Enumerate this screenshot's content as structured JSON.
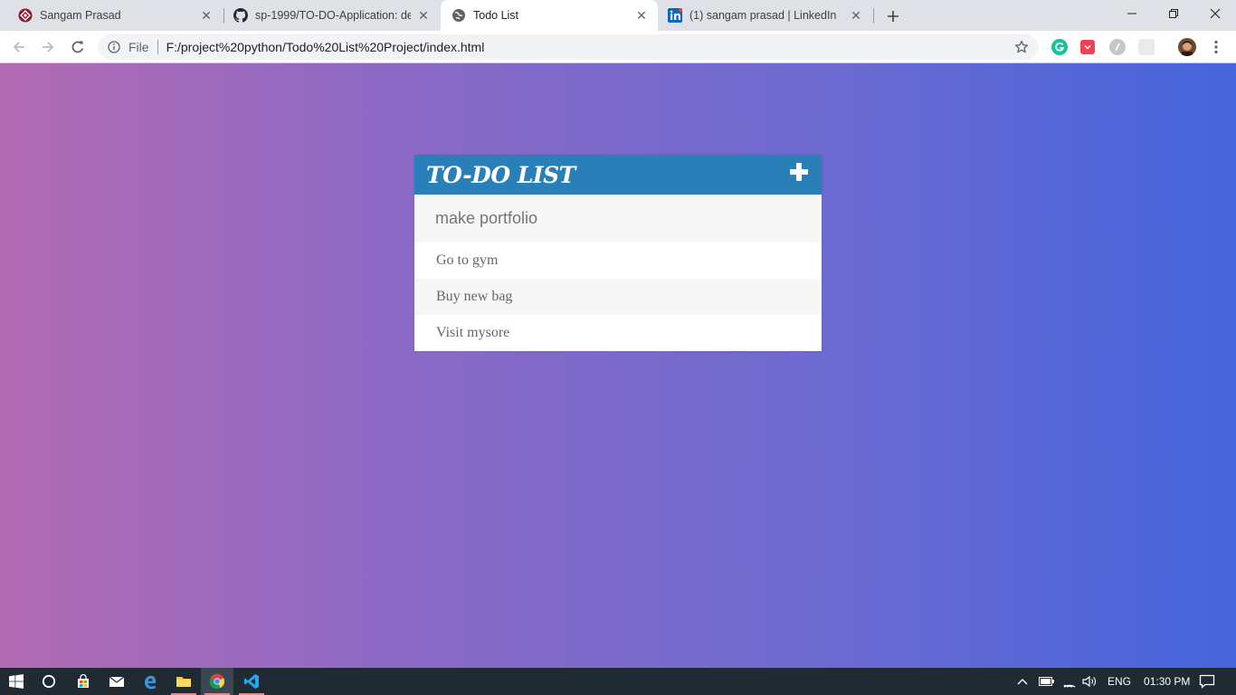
{
  "browser": {
    "tabs": [
      {
        "title": "Sangam Prasad",
        "icon": "sangam-favicon-icon",
        "active": false
      },
      {
        "title": "sp-1999/TO-DO-Application: des",
        "icon": "github-icon",
        "active": false
      },
      {
        "title": "Todo List",
        "icon": "globe-icon",
        "active": true
      },
      {
        "title": "(1) sangam prasad | LinkedIn",
        "icon": "linkedin-icon",
        "active": false
      }
    ],
    "omnibox": {
      "chip": "File",
      "url": "F:/project%20python/Todo%20List%20Project/index.html"
    }
  },
  "todo": {
    "title": "TO-DO LIST",
    "input_placeholder": "make portfolio",
    "items": [
      "Go to gym",
      "Buy new bag",
      "Visit mysore"
    ]
  },
  "taskbar": {
    "lang": "ENG",
    "time": "01:30 PM"
  },
  "colors": {
    "header": "#2980b9",
    "gradient_start": "#b26ab2",
    "gradient_end": "#4665dd"
  }
}
